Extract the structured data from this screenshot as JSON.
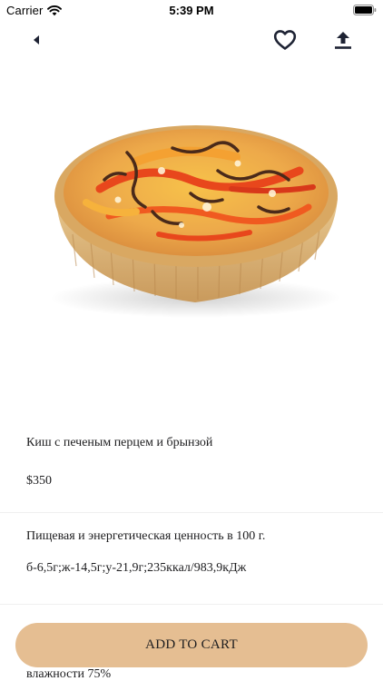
{
  "status_bar": {
    "carrier": "Carrier",
    "time": "5:39 PM",
    "icons": [
      "wifi-icon",
      "battery-icon"
    ]
  },
  "nav": {
    "icons": [
      "back-arrow-icon",
      "heart-icon",
      "share-upload-icon"
    ]
  },
  "product": {
    "image_subject": "quiche-tart",
    "name": "Киш с печеным перцем и брынзой",
    "price": "$350",
    "nutrition_title": "Пищевая и энергетическая ценность в 100 г.",
    "nutrition_values": "б-6,5г;ж-14,5г;у-21,9г;235ккал/983,9кДж",
    "humidity": "влажности 75%"
  },
  "cart": {
    "add_label": "ADD TO CART"
  },
  "colors": {
    "button_bg": "#e5be92",
    "icon": "#1d2233",
    "divider": "#efefef"
  }
}
